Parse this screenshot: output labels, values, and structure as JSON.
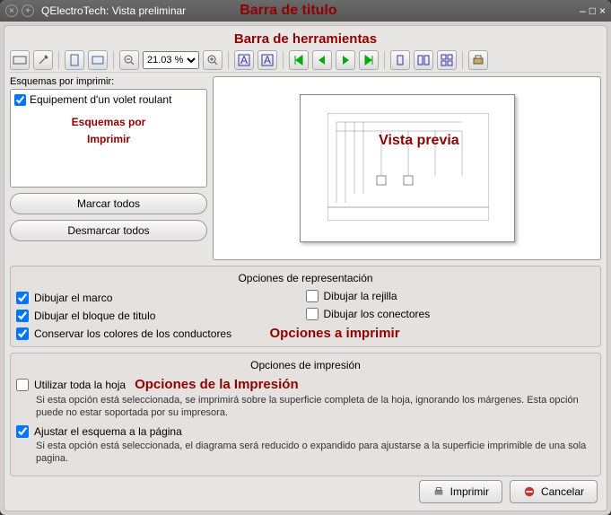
{
  "titlebar": {
    "title": "QElectroTech: Vista preliminar",
    "annot": "Barra de titulo"
  },
  "toolbar_annot": "Barra de herramientas",
  "zoom": "21.03 %",
  "left": {
    "label": "Esquemas por imprimir:",
    "item": "Equipement d'un volet roulant",
    "annot1": "Esquemas por",
    "annot2": "Imprimir",
    "mark_all": "Marcar todos",
    "unmark_all": "Desmarcar todos"
  },
  "preview_annot": "Vista previa",
  "repr": {
    "title": "Opciones de representación",
    "frame": "Dibujar el marco",
    "titleblock": "Dibujar el bloque de titulo",
    "colors": "Conservar los colores de los conductores",
    "grid": "Dibujar la rejilla",
    "connectors": "Dibujar los conectores",
    "annot": "Opciones a imprimir"
  },
  "impr": {
    "title": "Opciones de impresión",
    "annot": "Opciones de la Impresión",
    "use_all": "Utilizar toda la hoja",
    "use_all_desc": "Si esta opción está seleccionada, se imprimirá sobre la superficie completa de la hoja, ignorando los márgenes. Esta opción puede no estar soportada por su impresora.",
    "fit": "Ajustar el esquema a la página",
    "fit_desc": "Si esta opción está seleccionada, el diagrama será reducido o expandido para ajustarse a la superficie imprimible de una sola pagina."
  },
  "footer": {
    "print": "Imprimir",
    "cancel": "Cancelar"
  }
}
